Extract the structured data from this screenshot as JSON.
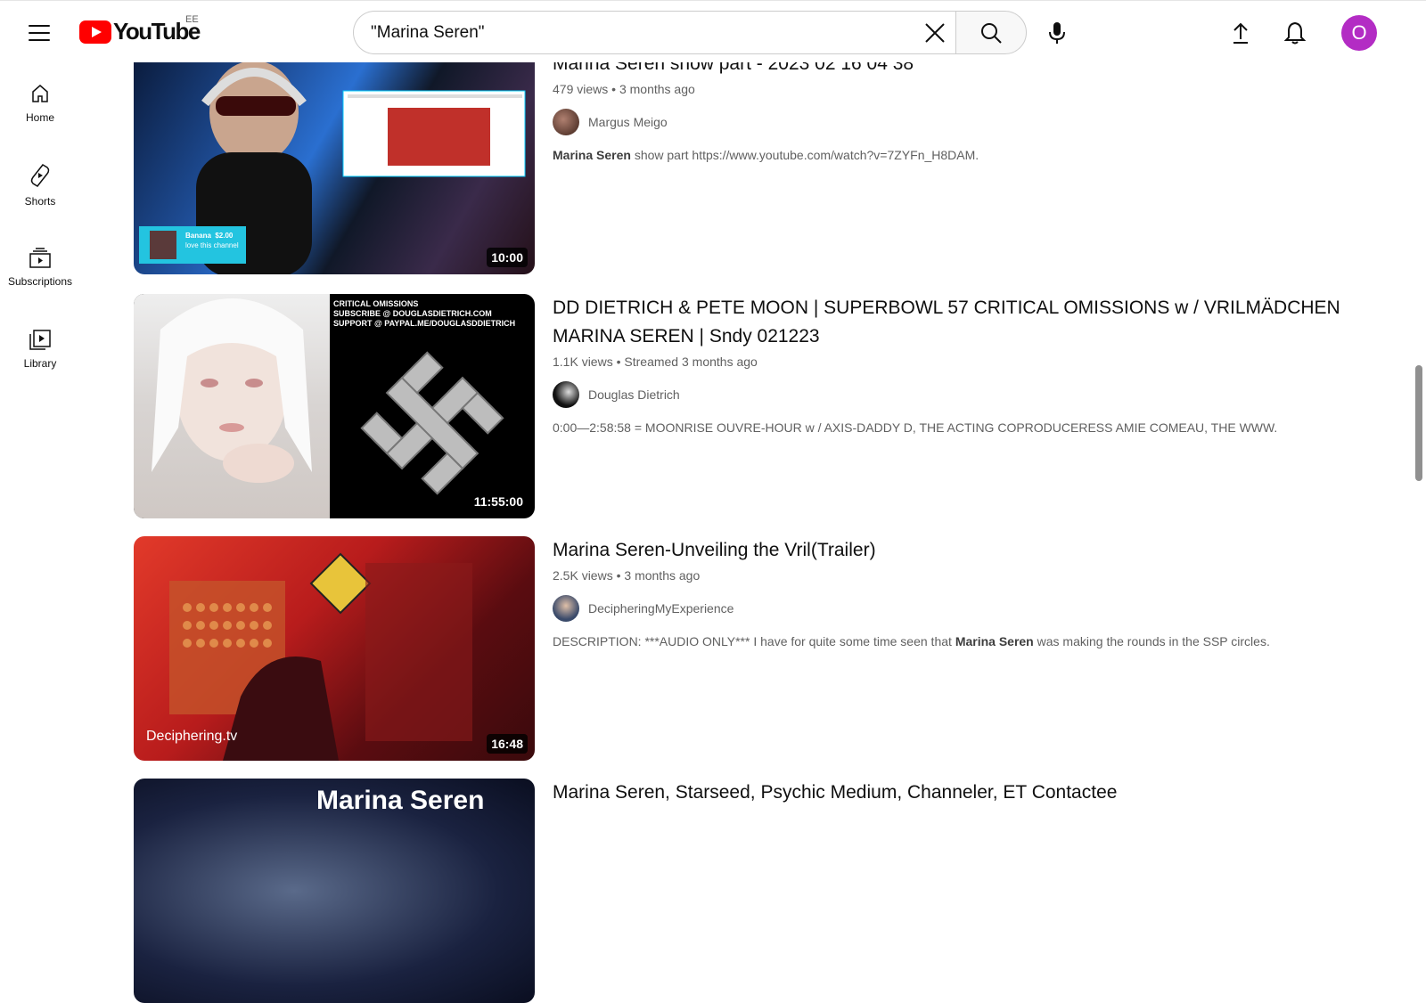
{
  "header": {
    "logo_text": "YouTube",
    "region": "EE",
    "search_value": "\"Marina Seren\"",
    "avatar_letter": "O"
  },
  "sidebar": {
    "items": [
      {
        "label": "Home",
        "icon": "home-icon"
      },
      {
        "label": "Shorts",
        "icon": "shorts-icon"
      },
      {
        "label": "Subscriptions",
        "icon": "subscriptions-icon"
      },
      {
        "label": "Library",
        "icon": "library-icon"
      }
    ]
  },
  "results": [
    {
      "title": "Marina Seren show part - 2023 02 16 04 38",
      "views": "479 views",
      "age": "3 months ago",
      "channel": "Margus Meigo",
      "desc_bold": "Marina Seren",
      "desc_rest": " show part https://www.youtube.com/watch?v=7ZYFn_H8DAM.",
      "duration": "10:00",
      "overlay_name": "Banana",
      "overlay_amount": "$2.00",
      "overlay_msg": "love this channel"
    },
    {
      "title": "DD DIETRICH & PETE MOON | SUPERBOWL 57 CRITICAL OMISSIONS w / VRILMÄDCHEN MARINA SEREN | Sndy 021223",
      "views": "1.1K views",
      "age": "Streamed 3 months ago",
      "channel": "Douglas Dietrich",
      "desc_pre": "0:00—2:58:58 = MOONRISE OUVRE-HOUR w / AXIS-DADDY D, THE ACTING COPRODUCERESS AMIE COMEAU, THE WWW.",
      "duration": "11:55:00",
      "thumb_text1": "CRITICAL OMISSIONS",
      "thumb_text2": "SUBSCRIBE @ DOUGLASDIETRICH.COM",
      "thumb_text3": "SUPPORT @ PAYPAL.ME/DOUGLASDDIETRICH"
    },
    {
      "title": "Marina Seren-Unveiling the Vril(Trailer)",
      "views": "2.5K views",
      "age": "3 months ago",
      "channel": "DecipheringMyExperience",
      "desc_pre": "DESCRIPTION: ***AUDIO ONLY*** I have for quite some time seen that ",
      "desc_bold": "Marina Seren",
      "desc_rest": " was making the rounds in the SSP circles.",
      "duration": "16:48",
      "watermark": "Deciphering.tv"
    },
    {
      "title": "Marina Seren, Starseed, Psychic Medium, Channeler, ET Contactee",
      "thumb_text": "Marina Seren"
    }
  ],
  "colors": {
    "brand_red": "#ff0000",
    "avatar_bg": "#b32cc4",
    "meta_gray": "#606060"
  }
}
